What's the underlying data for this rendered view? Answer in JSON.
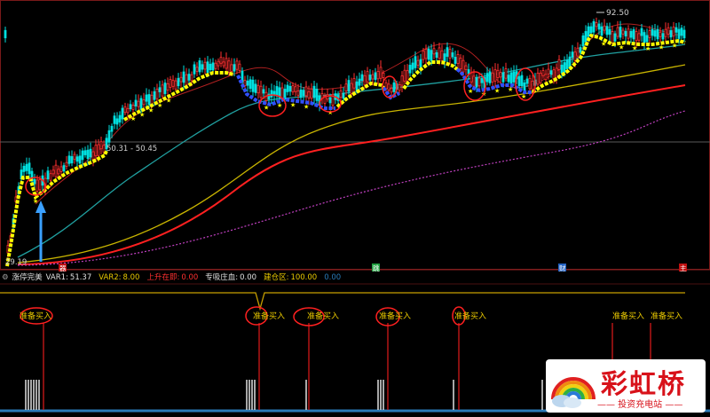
{
  "chart_data": [
    {
      "type": "line",
      "title": "",
      "price_labels": {
        "high": "92.50",
        "low": "29.19",
        "crosshair": "50.31 - 50.45"
      },
      "period_markers": [
        "器",
        "跳",
        "财",
        "主"
      ],
      "series": []
    },
    {
      "type": "bar",
      "indicator_name": "涨停完美",
      "signal_label": "准备买入"
    }
  ],
  "indicator_bar": {
    "name": "涨停完美",
    "var1_label": "VAR1:",
    "var1_value": "51.37",
    "var2_label": "VAR2:",
    "var2_value": "8.00",
    "rising_label": "上升在即:",
    "rising_value": "0.00",
    "zhuangxue_label": "专吸庄血:",
    "zhuangxue_value": "0.00",
    "jiancang_label": "建仓区:",
    "jiancang_value": "100.00",
    "extra_value": "0.00"
  },
  "signals": [
    {
      "label": "准备买入"
    },
    {
      "label": "准备买入"
    },
    {
      "label": "准备买入"
    },
    {
      "label": "准备买入"
    },
    {
      "label": "准备买入"
    },
    {
      "label": "准备买入"
    },
    {
      "label": "准备买入"
    }
  ],
  "logo": {
    "title": "彩虹桥",
    "subtitle": "—— 投资充电站 ——"
  },
  "colors": {
    "background": "#000000",
    "up_candle": "#ff3030",
    "down_candle": "#00e0e0",
    "yellow_trend": "#ffff00",
    "blue_trend": "#3050ff",
    "signal_text": "#e8c800",
    "red_line": "#ff2020",
    "ma_teal": "#20a0a0",
    "ma_gold": "#c8b400",
    "ma_purple": "#c040c0"
  }
}
